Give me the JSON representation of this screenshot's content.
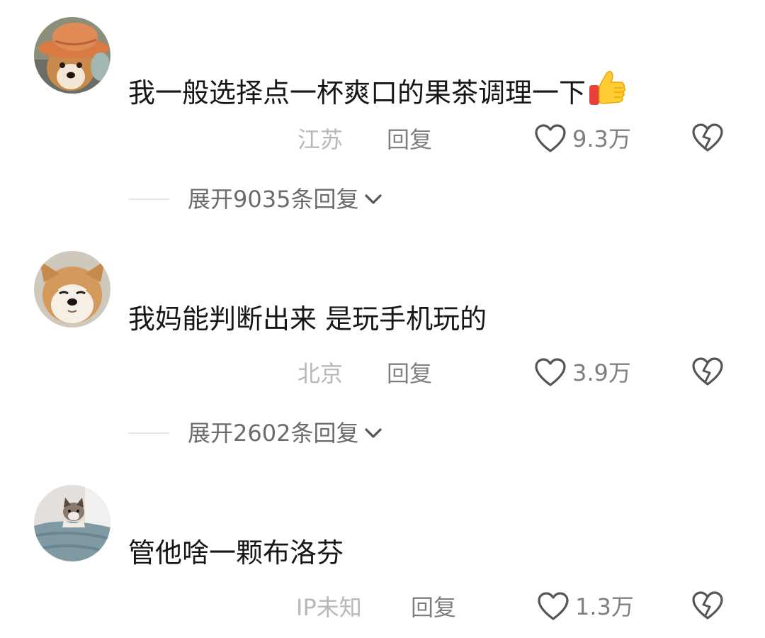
{
  "comments": [
    {
      "text": "我一般选择点一杯爽口的果茶调理一下",
      "has_thumbs_up_emoji": true,
      "location": "江苏",
      "reply_label": "回复",
      "likes": "9.3万",
      "expand_label": "展开9035条回复"
    },
    {
      "text": "我妈能判断出来 是玩手机玩的",
      "location": "北京",
      "reply_label": "回复",
      "likes": "3.9万",
      "expand_label": "展开2602条回复"
    },
    {
      "text": "管他啥一颗布洛芬",
      "location": "IP未知",
      "reply_label": "回复",
      "likes": "1.3万"
    }
  ],
  "icons": {
    "like": "heart-outline-icon",
    "dislike": "broken-heart-icon",
    "expand": "chevron-down-icon",
    "emoji": "thumbs-up-emoji"
  },
  "colors": {
    "comment_text": "#161616",
    "location_text": "#b8b8b8",
    "secondary_text": "#7f7f7f",
    "icon_stroke": "#555555",
    "divider": "#e4e4e4"
  }
}
